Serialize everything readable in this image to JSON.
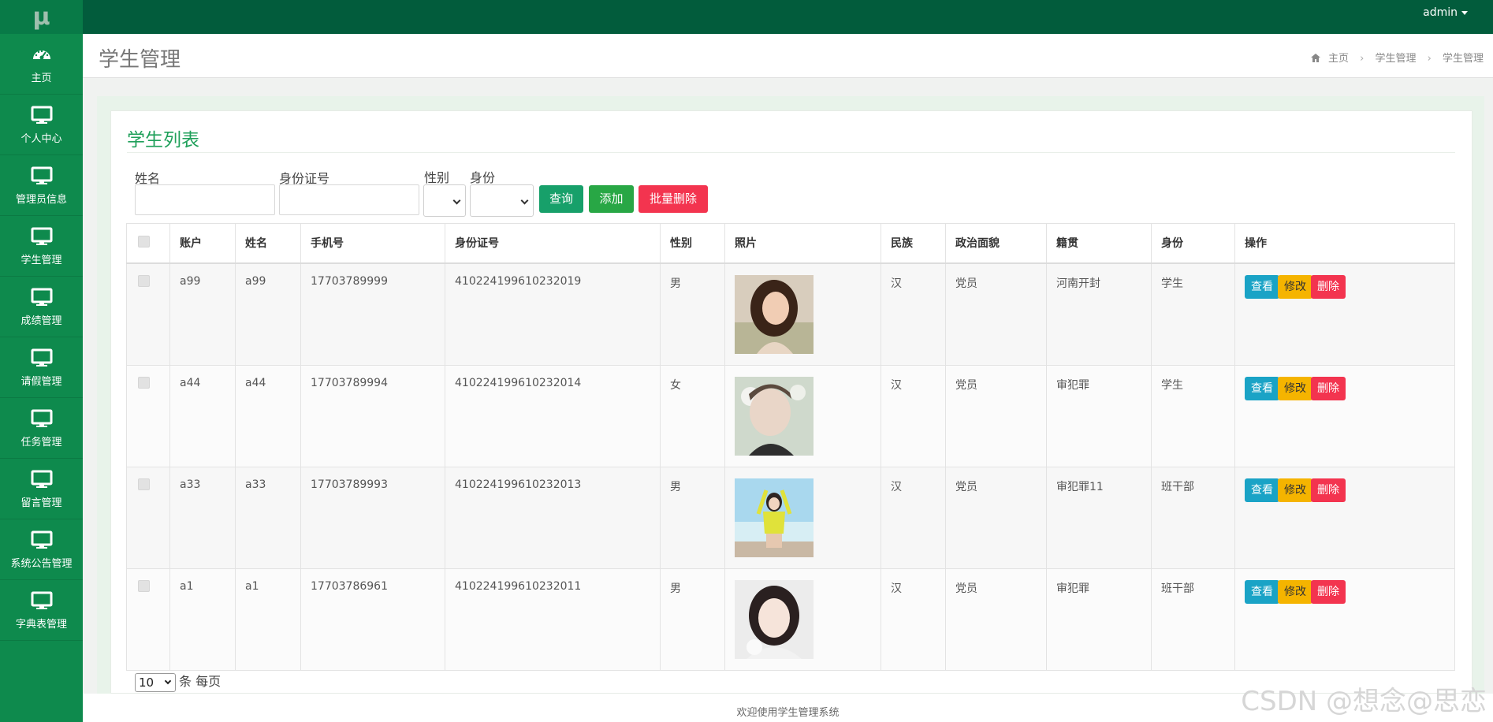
{
  "app": {
    "logo": "μ",
    "user": "admin"
  },
  "sidebar": {
    "items": [
      {
        "label": "主页",
        "icon": "dashboard-icon"
      },
      {
        "label": "个人中心",
        "icon": "monitor-icon"
      },
      {
        "label": "管理员信息",
        "icon": "monitor-icon"
      },
      {
        "label": "学生管理",
        "icon": "monitor-icon"
      },
      {
        "label": "成绩管理",
        "icon": "monitor-icon"
      },
      {
        "label": "请假管理",
        "icon": "monitor-icon"
      },
      {
        "label": "任务管理",
        "icon": "monitor-icon"
      },
      {
        "label": "留言管理",
        "icon": "monitor-icon"
      },
      {
        "label": "系统公告管理",
        "icon": "monitor-icon"
      },
      {
        "label": "字典表管理",
        "icon": "monitor-icon"
      }
    ]
  },
  "header": {
    "title": "学生管理",
    "breadcrumb": [
      "主页",
      "学生管理",
      "学生管理"
    ]
  },
  "main": {
    "list_title": "学生列表",
    "filters": {
      "name_label": "姓名",
      "id_label": "身份证号",
      "gender_label": "性别",
      "identity_label": "身份"
    },
    "buttons": {
      "query": "查询",
      "add": "添加",
      "batch_delete": "批量删除"
    },
    "table": {
      "headers": [
        "账户",
        "姓名",
        "手机号",
        "身份证号",
        "性别",
        "照片",
        "民族",
        "政治面貌",
        "籍贯",
        "身份",
        "操作"
      ],
      "rows": [
        {
          "account": "a99",
          "name": "a99",
          "phone": "17703789999",
          "id_card": "410224199610232019",
          "gender": "男",
          "ethnicity": "汉",
          "political": "党员",
          "hometown": "河南开封",
          "identity": "学生"
        },
        {
          "account": "a44",
          "name": "a44",
          "phone": "17703789994",
          "id_card": "410224199610232014",
          "gender": "女",
          "ethnicity": "汉",
          "political": "党员",
          "hometown": "审犯罪",
          "identity": "学生"
        },
        {
          "account": "a33",
          "name": "a33",
          "phone": "17703789993",
          "id_card": "410224199610232013",
          "gender": "男",
          "ethnicity": "汉",
          "political": "党员",
          "hometown": "审犯罪11",
          "identity": "班干部"
        },
        {
          "account": "a1",
          "name": "a1",
          "phone": "17703786961",
          "id_card": "410224199610232011",
          "gender": "男",
          "ethnicity": "汉",
          "political": "党员",
          "hometown": "审犯罪",
          "identity": "班干部"
        }
      ],
      "row_actions": {
        "view": "查看",
        "edit": "修改",
        "delete": "删除"
      }
    },
    "pager": {
      "page_size": "10",
      "suffix": "条 每页"
    }
  },
  "footer": {
    "text": "欢迎使用学生管理系统"
  },
  "watermark": "CSDN @想念@思恋",
  "colors": {
    "topbar": "#025c3c",
    "sidebar": "#0e8a4d",
    "accent": "#1fa05a",
    "query": "#17a06a",
    "add": "#28a745",
    "delete": "#f3344f",
    "view": "#1aa3c6",
    "edit": "#f5b400"
  }
}
